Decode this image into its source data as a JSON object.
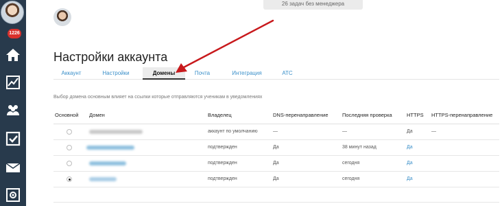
{
  "header": {
    "top_info": "26 задач без менеджера"
  },
  "sidebar": {
    "badge": "1226",
    "icons": [
      "home-icon",
      "chart-icon",
      "users-icon",
      "checkbox-icon",
      "mail-icon",
      "settings-icon"
    ]
  },
  "page": {
    "title": "Настройки аккаунта",
    "hint": "Выбор домена основным влияет на ссылки которые отправляются ученикам в уведомлениях"
  },
  "tabs": [
    {
      "label": "Аккаунт",
      "active": false
    },
    {
      "label": "Настройки",
      "active": false
    },
    {
      "label": "Домены",
      "active": true
    },
    {
      "label": "Почта",
      "active": false
    },
    {
      "label": "Интеграция",
      "active": false
    },
    {
      "label": "АТС",
      "active": false
    }
  ],
  "table": {
    "columns": [
      "Основной",
      "Домен",
      "Владелец",
      "DNS-перенаправление",
      "Последняя проверка",
      "HTTPS",
      "HTTPS-перенаправление"
    ],
    "rows": [
      {
        "selected": false,
        "owner": "аккаунт по умолчанию",
        "dns": "—",
        "last_check": "—",
        "https": "Да",
        "https_redirect": "—"
      },
      {
        "selected": false,
        "owner": "подтвержден",
        "dns": "Да",
        "last_check": "38 минут назад",
        "https": "Да",
        "https_redirect": ""
      },
      {
        "selected": false,
        "owner": "подтвержден",
        "dns": "Да",
        "last_check": "сегодня",
        "https": "Да",
        "https_redirect": ""
      },
      {
        "selected": true,
        "owner": "подтвержден",
        "dns": "Да",
        "last_check": "сегодня",
        "https": "Да",
        "https_redirect": ""
      }
    ]
  },
  "colors": {
    "sidebar": "#283a4c",
    "link": "#3a8fc9",
    "arrow": "#c8191c",
    "badge": "#d9302c"
  }
}
